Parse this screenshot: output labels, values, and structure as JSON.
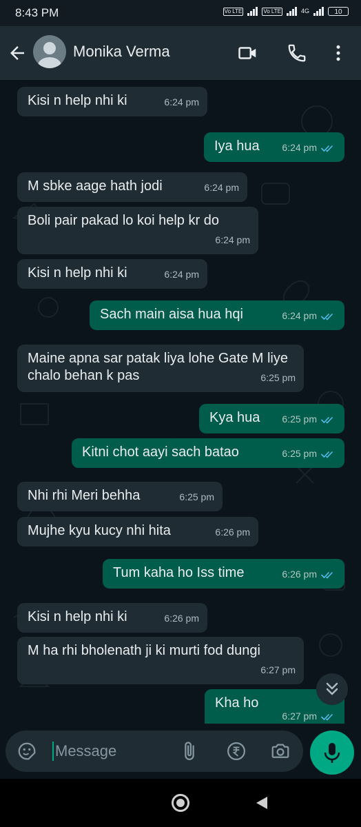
{
  "status_bar": {
    "time": "8:43 PM",
    "volte1": "Vo LTE",
    "volte2": "Vo LTE",
    "network": "4G",
    "battery": "10"
  },
  "header": {
    "contact_name": "Monika Verma"
  },
  "messages": [
    {
      "dir": "in",
      "text": "Kisi n help nhi ki",
      "time": "6:24 pm"
    },
    {
      "dir": "out",
      "text": "Iya hua",
      "time": "6:24 pm",
      "read": true
    },
    {
      "dir": "in",
      "text": "M sbke aage hath jodi",
      "time": "6:24 pm"
    },
    {
      "dir": "in",
      "text": "Boli pair pakad lo koi help kr do",
      "time": "6:24 pm"
    },
    {
      "dir": "in",
      "text": "Kisi n help nhi ki",
      "time": "6:24 pm"
    },
    {
      "dir": "out",
      "text": "Sach main aisa hua hqi",
      "time": "6:24 pm",
      "read": true
    },
    {
      "dir": "in",
      "text": "Maine apna sar patak liya lohe Gate M liye chalo behan k pas",
      "time": "6:25 pm"
    },
    {
      "dir": "out",
      "text": "Kya hua",
      "time": "6:25 pm",
      "read": true
    },
    {
      "dir": "out",
      "text": "Kitni chot aayi sach batao",
      "time": "6:25 pm",
      "read": true
    },
    {
      "dir": "in",
      "text": "Nhi rhi Meri behha",
      "time": "6:25 pm"
    },
    {
      "dir": "in",
      "text": "Mujhe kyu kucy nhi hita",
      "time": "6:26 pm"
    },
    {
      "dir": "out",
      "text": "Tum kaha ho Iss time",
      "time": "6:26 pm",
      "read": true
    },
    {
      "dir": "in",
      "text": "Kisi n help nhi ki",
      "time": "6:26 pm"
    },
    {
      "dir": "in",
      "text": "M ha rhi bholenath ji ki murti fod dungi",
      "time": "6:27 pm"
    },
    {
      "dir": "out",
      "text": "Kha ho",
      "time": "6:27 pm",
      "read": true
    }
  ],
  "composer": {
    "placeholder": "Message"
  },
  "icons": {
    "back": "arrow-left-icon",
    "avatar": "default-avatar-icon",
    "video": "video-call-icon",
    "call": "phone-icon",
    "menu": "more-vert-icon",
    "scroll": "double-chevron-down-icon",
    "sticker": "sticker-icon",
    "attach": "paperclip-icon",
    "payment": "rupee-icon",
    "camera": "camera-icon",
    "mic": "microphone-icon"
  },
  "colors": {
    "incoming": "#1f2c34",
    "outgoing": "#005c4b",
    "accent": "#00a884",
    "read_ticks": "#53bdeb"
  }
}
